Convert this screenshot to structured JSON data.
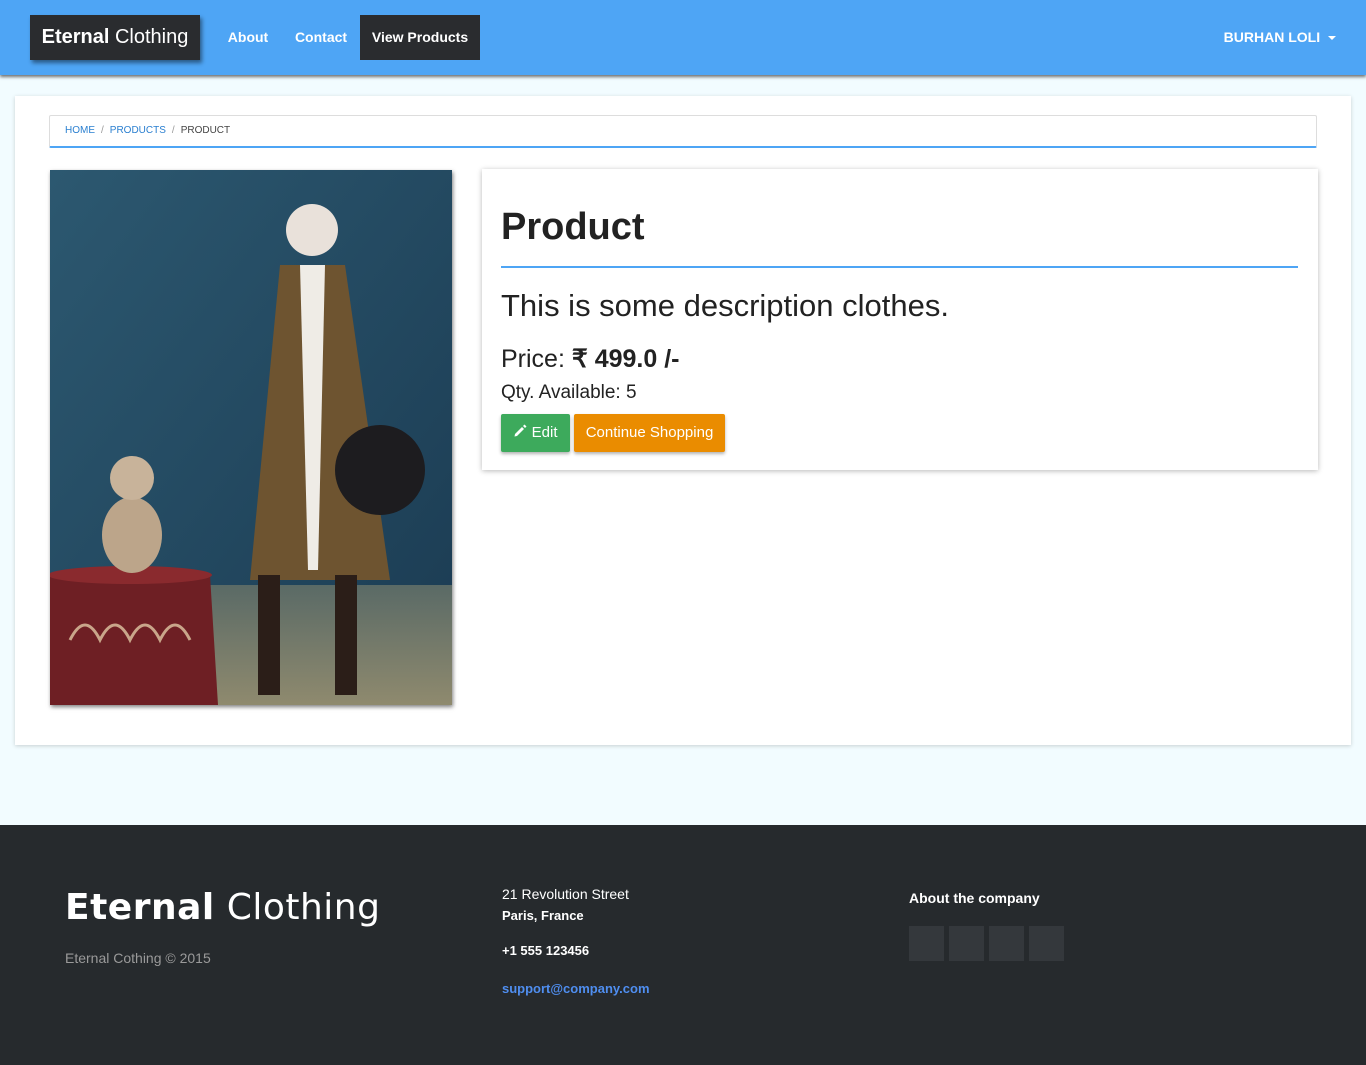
{
  "navbar": {
    "brand_bold": "Eternal",
    "brand_light": "Clothing",
    "links": [
      "About",
      "Contact",
      "View Products"
    ],
    "user": "BURHAN LOLI"
  },
  "breadcrumb": {
    "items": [
      "HOME",
      "PRODUCTS"
    ],
    "current": "PRODUCT"
  },
  "product": {
    "title": "Product",
    "description": "This is some description clothes.",
    "price_label": "Price:",
    "price_value": "₹ 499.0 /-",
    "qty_label": "Qty. Available:",
    "qty_value": "5",
    "edit_label": "Edit",
    "continue_label": "Continue Shopping"
  },
  "footer": {
    "logo_bold": "Eternal",
    "logo_light": "Clothing",
    "copyright": "Eternal Cothing © 2015",
    "street": "21 Revolution Street",
    "city": "Paris, France",
    "phone": "+1 555 123456",
    "email": "support@company.com",
    "about_heading": "About the company",
    "social_icons": [
      "facebook-icon",
      "twitter-icon",
      "linkedin-icon",
      "github-icon"
    ]
  },
  "colors": {
    "navbar": "#4ea5f5",
    "brand_bg": "#2a2c2f",
    "edit_button": "#3daa5c",
    "continue_button": "#ea8c00",
    "footer_bg": "#262a2d",
    "accent_link": "#4f8ef0"
  }
}
